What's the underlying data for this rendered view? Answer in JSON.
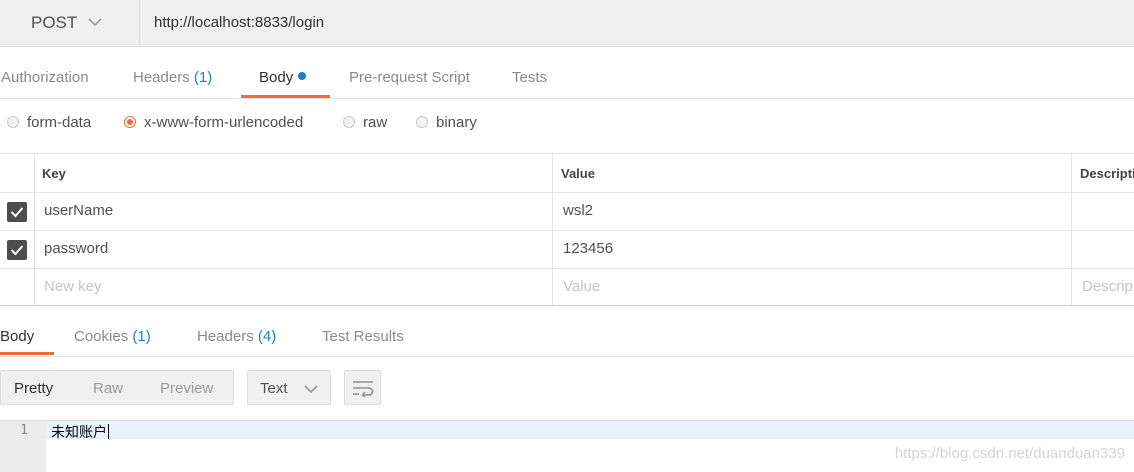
{
  "request": {
    "method": "POST",
    "url": "http://localhost:8833/login"
  },
  "request_tabs": {
    "authorization": "Authorization",
    "headers": "Headers",
    "headers_count": "(1)",
    "body": "Body",
    "prerequest": "Pre-request Script",
    "tests": "Tests"
  },
  "body_types": {
    "form_data": "form-data",
    "urlencoded": "x-www-form-urlencoded",
    "raw": "raw",
    "binary": "binary",
    "selected": "x-www-form-urlencoded"
  },
  "params": {
    "headers": {
      "key": "Key",
      "value": "Value",
      "description": "Descripti"
    },
    "rows": [
      {
        "key": "userName",
        "value": "wsl2",
        "checked": true
      },
      {
        "key": "password",
        "value": "123456",
        "checked": true
      }
    ],
    "placeholders": {
      "key": "New key",
      "value": "Value",
      "description": "Descrip"
    }
  },
  "response_tabs": {
    "body": "Body",
    "cookies": "Cookies",
    "cookies_count": "(1)",
    "headers": "Headers",
    "headers_count": "(4)",
    "test_results": "Test Results"
  },
  "response_view": {
    "pretty": "Pretty",
    "raw": "Raw",
    "preview": "Preview",
    "format": "Text"
  },
  "editor": {
    "line_number": "1",
    "content": "未知账户"
  },
  "watermark": "https://blog.csdn.net/duanduan339",
  "colors": {
    "accent": "#f26b3a",
    "link_blue": "#1a7fd4"
  }
}
